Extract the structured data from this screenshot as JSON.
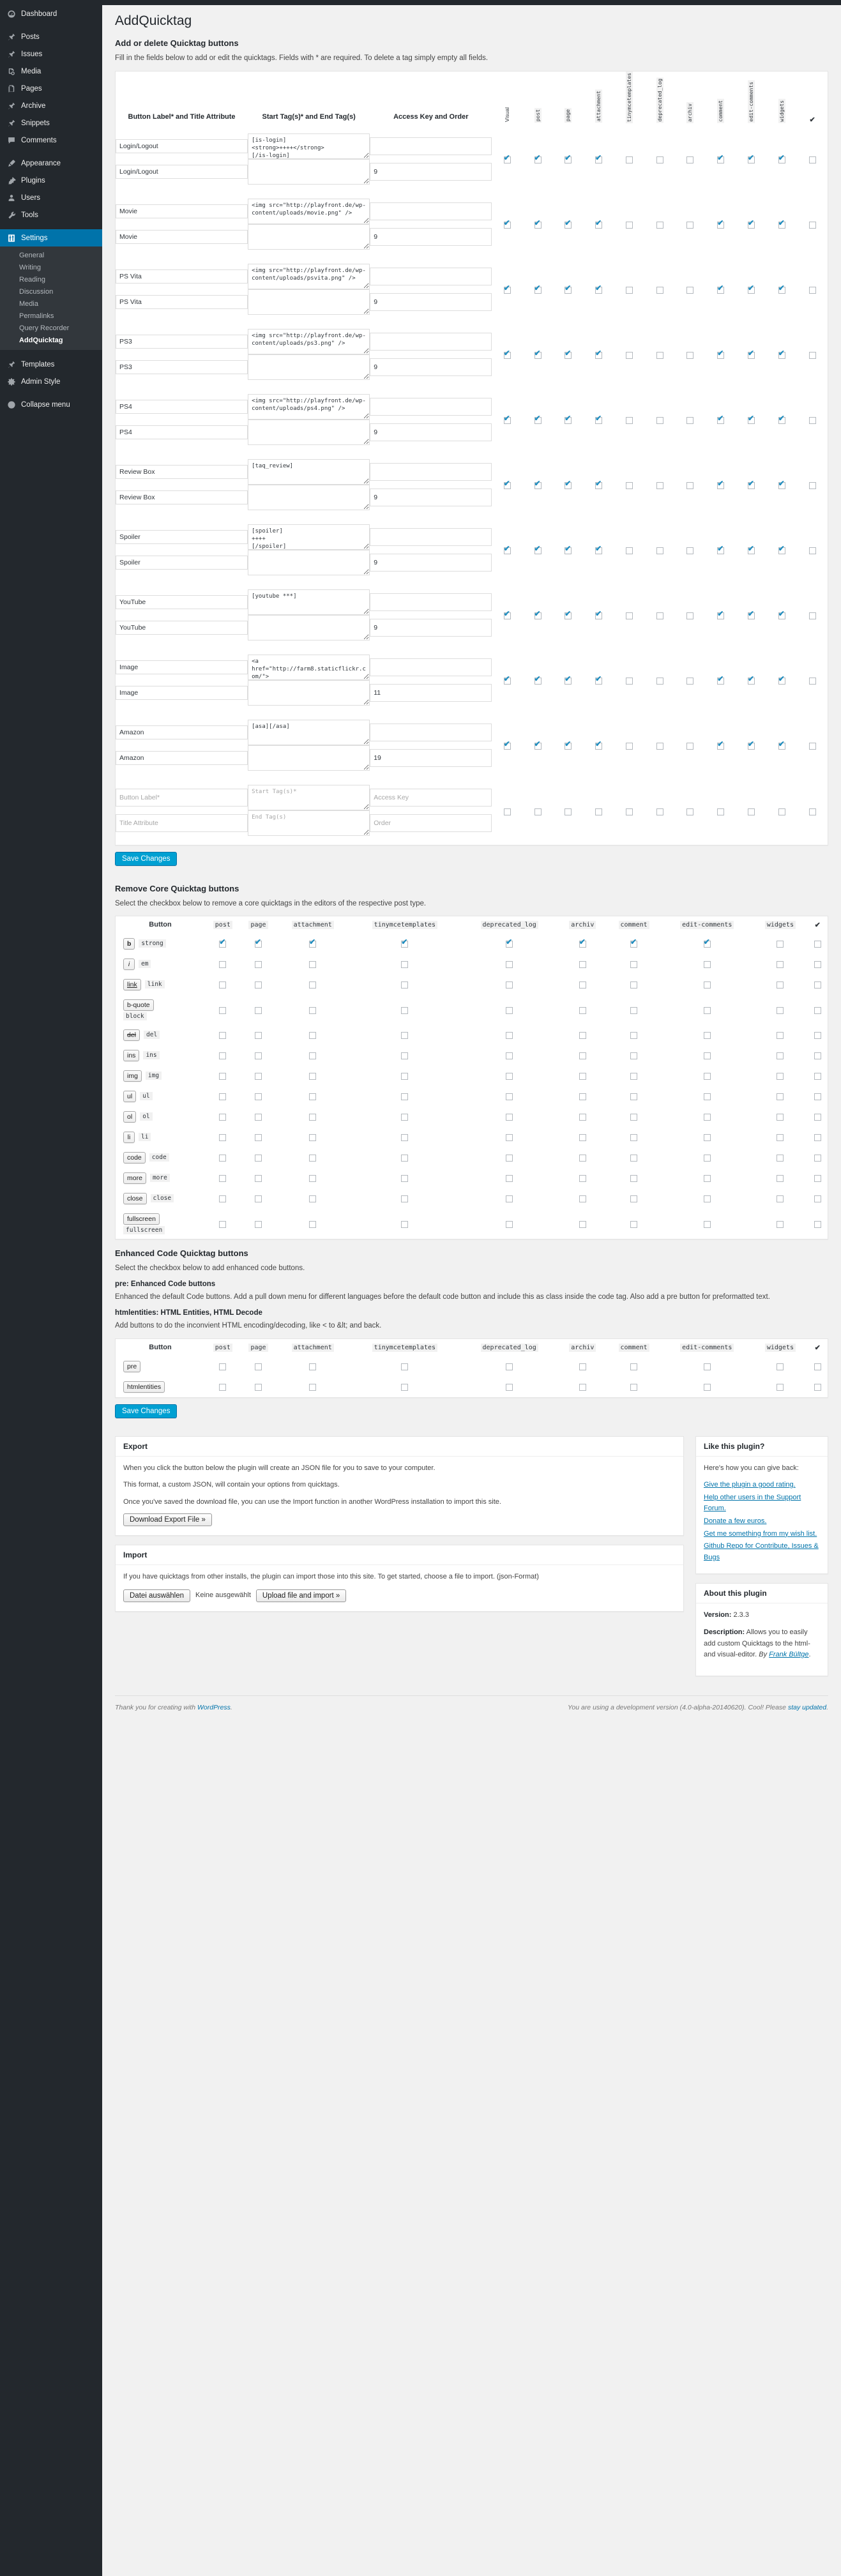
{
  "sidebar": {
    "items": [
      {
        "label": "Dashboard",
        "icon": "dashboard-icon",
        "current": false
      },
      {
        "label": "Posts",
        "icon": "pin-icon",
        "current": false
      },
      {
        "label": "Issues",
        "icon": "pin-icon",
        "current": false
      },
      {
        "label": "Media",
        "icon": "media-icon",
        "current": false
      },
      {
        "label": "Pages",
        "icon": "pages-icon",
        "current": false
      },
      {
        "label": "Archive",
        "icon": "pin-icon",
        "current": false
      },
      {
        "label": "Snippets",
        "icon": "pin-icon",
        "current": false
      },
      {
        "label": "Comments",
        "icon": "comment-icon",
        "current": false
      },
      {
        "label": "Appearance",
        "icon": "brush-icon",
        "current": false
      },
      {
        "label": "Plugins",
        "icon": "plug-icon",
        "current": false
      },
      {
        "label": "Users",
        "icon": "user-icon",
        "current": false
      },
      {
        "label": "Tools",
        "icon": "wrench-icon",
        "current": false
      },
      {
        "label": "Settings",
        "icon": "settings-icon",
        "current": true
      }
    ],
    "submenu": [
      {
        "label": "General",
        "current": false
      },
      {
        "label": "Writing",
        "current": false
      },
      {
        "label": "Reading",
        "current": false
      },
      {
        "label": "Discussion",
        "current": false
      },
      {
        "label": "Media",
        "current": false
      },
      {
        "label": "Permalinks",
        "current": false
      },
      {
        "label": "Query Recorder",
        "current": false
      },
      {
        "label": "AddQuicktag",
        "current": true
      }
    ],
    "after": [
      {
        "label": "Templates",
        "icon": "pin-icon"
      },
      {
        "label": "Admin Style",
        "icon": "gear-icon"
      },
      {
        "label": "Collapse menu",
        "icon": "collapse-icon"
      }
    ]
  },
  "page": {
    "title": "AddQuicktag"
  },
  "add_section": {
    "heading": "Add or delete Quicktag buttons",
    "description": "Fill in the fields below to add or edit the quicktags. Fields with * are required. To delete a tag simply empty all fields.",
    "col_headers": [
      "Button Label* and Title Attribute",
      "Start Tag(s)* and End Tag(s)",
      "Access Key and Order"
    ],
    "vertical_headers": [
      "Visual",
      "post",
      "page",
      "attachment",
      "tinymcetemplates",
      "deprecated_log",
      "archiv",
      "comment",
      "edit-comments",
      "widgets",
      "✔"
    ],
    "save_label": "Save Changes",
    "rows": [
      {
        "label": "Login/Logout",
        "title": "Login/Logout",
        "start_tag": "[is-login]\n<strong>++++</strong>\n[/is-login]",
        "end_tag": "",
        "access_key": "",
        "order": "9",
        "checks": [
          true,
          true,
          true,
          true,
          false,
          false,
          false,
          true,
          true,
          true,
          false
        ]
      },
      {
        "label": "Movie",
        "title": "Movie",
        "start_tag": "<img src=\"http://playfront.de/wp-content/uploads/movie.png\" />",
        "end_tag": "",
        "access_key": "",
        "order": "9",
        "checks": [
          true,
          true,
          true,
          true,
          false,
          false,
          false,
          true,
          true,
          true,
          false
        ]
      },
      {
        "label": "PS Vita",
        "title": "PS Vita",
        "start_tag": "<img src=\"http://playfront.de/wp-content/uploads/psvita.png\" />",
        "end_tag": "",
        "access_key": "",
        "order": "9",
        "checks": [
          true,
          true,
          true,
          true,
          false,
          false,
          false,
          true,
          true,
          true,
          false
        ]
      },
      {
        "label": "PS3",
        "title": "PS3",
        "start_tag": "<img src=\"http://playfront.de/wp-content/uploads/ps3.png\" />",
        "end_tag": "",
        "access_key": "",
        "order": "9",
        "checks": [
          true,
          true,
          true,
          true,
          false,
          false,
          false,
          true,
          true,
          true,
          false
        ]
      },
      {
        "label": "PS4",
        "title": "PS4",
        "start_tag": "<img src=\"http://playfront.de/wp-content/uploads/ps4.png\" />",
        "end_tag": "",
        "access_key": "",
        "order": "9",
        "checks": [
          true,
          true,
          true,
          true,
          false,
          false,
          false,
          true,
          true,
          true,
          false
        ]
      },
      {
        "label": "Review Box",
        "title": "Review Box",
        "start_tag": "[taq_review]",
        "end_tag": "",
        "access_key": "",
        "order": "9",
        "checks": [
          true,
          true,
          true,
          true,
          false,
          false,
          false,
          true,
          true,
          true,
          false
        ]
      },
      {
        "label": "Spoiler",
        "title": "Spoiler",
        "start_tag": "[spoiler]\n++++\n[/spoiler]",
        "end_tag": "",
        "access_key": "",
        "order": "9",
        "checks": [
          true,
          true,
          true,
          true,
          false,
          false,
          false,
          true,
          true,
          true,
          false
        ]
      },
      {
        "label": "YouTube",
        "title": "YouTube",
        "start_tag": "[youtube ***]",
        "end_tag": "",
        "access_key": "",
        "order": "9",
        "checks": [
          true,
          true,
          true,
          true,
          false,
          false,
          false,
          true,
          true,
          true,
          false
        ]
      },
      {
        "label": "Image",
        "title": "Image",
        "start_tag": "<a href=\"http://farm8.staticflickr.com/\">",
        "end_tag": "",
        "access_key": "",
        "order": "11",
        "checks": [
          true,
          true,
          true,
          true,
          false,
          false,
          false,
          true,
          true,
          true,
          false
        ]
      },
      {
        "label": "Amazon",
        "title": "Amazon",
        "start_tag": "[asa][/asa]",
        "end_tag": "",
        "access_key": "",
        "order": "19",
        "checks": [
          true,
          true,
          true,
          true,
          false,
          false,
          false,
          true,
          true,
          true,
          false
        ]
      }
    ],
    "empty_row": {
      "label_placeholder": "Button Label*",
      "title_placeholder": "Title Attribute",
      "start_placeholder": "Start Tag(s)*",
      "end_placeholder": "End Tag(s)",
      "access_placeholder": "Access Key",
      "order_placeholder": "Order",
      "checks": [
        false,
        false,
        false,
        false,
        false,
        false,
        false,
        false,
        false,
        false,
        false
      ]
    }
  },
  "remove_section": {
    "heading": "Remove Core Quicktag buttons",
    "description": "Select the checkbox below to remove a core quicktags in the editors of the respective post type.",
    "headers": [
      "Button",
      "post",
      "page",
      "attachment",
      "tinymcetemplates",
      "deprecated_log",
      "archiv",
      "comment",
      "edit-comments",
      "widgets",
      "✔"
    ],
    "rows": [
      {
        "btn": "b",
        "code": "strong",
        "style": "bold",
        "checks": [
          true,
          true,
          true,
          true,
          true,
          true,
          true,
          true,
          false
        ]
      },
      {
        "btn": "i",
        "code": "em",
        "style": "italic",
        "checks": [
          false,
          false,
          false,
          false,
          false,
          false,
          false,
          false,
          false
        ]
      },
      {
        "btn": "link",
        "code": "link",
        "style": "underline",
        "checks": [
          false,
          false,
          false,
          false,
          false,
          false,
          false,
          false,
          false
        ]
      },
      {
        "btn": "b-quote",
        "code": "block",
        "style": "normal",
        "stacked": true,
        "checks": [
          false,
          false,
          false,
          false,
          false,
          false,
          false,
          false,
          false
        ]
      },
      {
        "btn": "del",
        "code": "del",
        "style": "strike",
        "checks": [
          false,
          false,
          false,
          false,
          false,
          false,
          false,
          false,
          false
        ]
      },
      {
        "btn": "ins",
        "code": "ins",
        "style": "normal",
        "checks": [
          false,
          false,
          false,
          false,
          false,
          false,
          false,
          false,
          false
        ]
      },
      {
        "btn": "img",
        "code": "img",
        "style": "normal",
        "checks": [
          false,
          false,
          false,
          false,
          false,
          false,
          false,
          false,
          false
        ]
      },
      {
        "btn": "ul",
        "code": "ul",
        "style": "normal",
        "checks": [
          false,
          false,
          false,
          false,
          false,
          false,
          false,
          false,
          false
        ]
      },
      {
        "btn": "ol",
        "code": "ol",
        "style": "normal",
        "checks": [
          false,
          false,
          false,
          false,
          false,
          false,
          false,
          false,
          false
        ]
      },
      {
        "btn": "li",
        "code": "li",
        "style": "normal",
        "checks": [
          false,
          false,
          false,
          false,
          false,
          false,
          false,
          false,
          false
        ]
      },
      {
        "btn": "code",
        "code": "code",
        "style": "normal",
        "checks": [
          false,
          false,
          false,
          false,
          false,
          false,
          false,
          false,
          false
        ]
      },
      {
        "btn": "more",
        "code": "more",
        "style": "normal",
        "checks": [
          false,
          false,
          false,
          false,
          false,
          false,
          false,
          false,
          false
        ]
      },
      {
        "btn": "close",
        "code": "close",
        "style": "normal",
        "checks": [
          false,
          false,
          false,
          false,
          false,
          false,
          false,
          false,
          false
        ]
      },
      {
        "btn": "fullscreen",
        "code": "fullscreen",
        "style": "normal",
        "stacked": true,
        "checks": [
          false,
          false,
          false,
          false,
          false,
          false,
          false,
          false,
          false
        ]
      }
    ]
  },
  "enhanced_section": {
    "heading": "Enhanced Code Quicktag buttons",
    "description": "Select the checkbox below to add enhanced code buttons.",
    "sub1_title": "pre: Enhanced Code buttons",
    "sub1_text": "Enhanced the default Code buttons. Add a pull down menu for different languages before the default code button and include this as class inside the code tag. Also add a pre button for preformatted text.",
    "sub2_title": "htmlentities: HTML Entities, HTML Decode",
    "sub2_text": "Add buttons to do the inconvient HTML encoding/decoding, like < to &lt; and back.",
    "headers": [
      "Button",
      "post",
      "page",
      "attachment",
      "tinymcetemplates",
      "deprecated_log",
      "archiv",
      "comment",
      "edit-comments",
      "widgets",
      "✔"
    ],
    "rows": [
      {
        "btn": "pre",
        "checks": [
          false,
          false,
          false,
          false,
          false,
          false,
          false,
          false,
          false
        ]
      },
      {
        "btn": "htmlentities",
        "checks": [
          false,
          false,
          false,
          false,
          false,
          false,
          false,
          false,
          false
        ]
      }
    ],
    "save_label": "Save Changes"
  },
  "export_box": {
    "title": "Export",
    "p1": "When you click the button below the plugin will create an JSON file for you to save to your computer.",
    "p2": "This format, a custom JSON, will contain your options from quicktags.",
    "p3": "Once you've saved the download file, you can use the Import function in another WordPress installation to import this site.",
    "button": "Download Export File »"
  },
  "import_box": {
    "title": "Import",
    "p1": "If you have quicktags from other installs, the plugin can import those into this site. To get started, choose a file to import. (json-Format)",
    "file_button": "Datei auswählen",
    "file_status": "Keine ausgewählt",
    "upload_button": "Upload file and import »"
  },
  "like_box": {
    "title": "Like this plugin?",
    "intro": "Here's how you can give back:",
    "links": [
      "Give the plugin a good rating.",
      "Help other users in the Support Forum.",
      "Donate a few euros.",
      "Get me something from my wish list.",
      "Github Repo for Contribute, Issues & Bugs"
    ]
  },
  "about_box": {
    "title": "About this plugin",
    "version_label": "Version:",
    "version": "2.3.3",
    "description_label": "Description:",
    "description": "Allows you to easily add custom Quicktags to the html- and visual-editor.",
    "by_label": "By",
    "author": "Frank Bültge"
  },
  "footer": {
    "thanks_prefix": "Thank you for creating with",
    "thanks_link": "WordPress",
    "right": "You are using a development version (4.0-alpha-20140620). Cool! Please",
    "right_link": "stay updated"
  },
  "colors": {
    "accent": "#0073aa",
    "primary_button": "#00a0d2",
    "sidebar_bg": "#23282d",
    "submenu_bg": "#32373c",
    "check": "#1e8cbe"
  }
}
